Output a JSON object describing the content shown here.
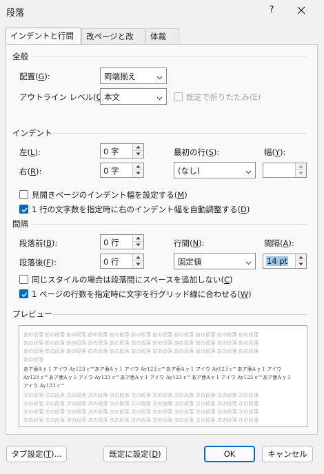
{
  "window": {
    "title": "段落",
    "help": "?"
  },
  "tabs": [
    {
      "label": "インデントと行間隔"
    },
    {
      "label": "改ページと改行"
    },
    {
      "label": "体裁"
    }
  ],
  "general": {
    "heading": "全般",
    "alignment": {
      "label_pre": "配置(",
      "key": "G",
      "label_post": "):",
      "value": "両端揃え"
    },
    "outline": {
      "label_pre": "アウトライン レベル(",
      "key": "O",
      "label_post": "):",
      "value": "本文"
    },
    "collapse": {
      "label": "既定で折りたたみ(E)",
      "checked": false,
      "enabled": false
    }
  },
  "indent": {
    "heading": "インデント",
    "left": {
      "label_pre": "左(",
      "key": "L",
      "label_post": "):",
      "value": "0 字"
    },
    "right": {
      "label_pre": "右(",
      "key": "R",
      "label_post": "):",
      "value": "0 字"
    },
    "first_line": {
      "label_pre": "最初の行(",
      "key": "S",
      "label_post": "):",
      "value": "(なし)"
    },
    "width": {
      "label_pre": "幅(",
      "key": "Y",
      "label_post": "):",
      "value": ""
    },
    "mirror": {
      "label_pre": "見開きページのインデント幅を設定する(",
      "key": "M",
      "label_post": ")",
      "checked": false
    },
    "auto_adjust": {
      "label_pre": "1 行の文字数を指定時に右のインデント幅を自動調整する(",
      "key": "D",
      "label_post": ")",
      "checked": true
    }
  },
  "spacing": {
    "heading": "間隔",
    "before": {
      "label_pre": "段落前(",
      "key": "B",
      "label_post": "):",
      "value": "0 行"
    },
    "after": {
      "label_pre": "段落後(",
      "key": "F",
      "label_post": "):",
      "value": "0 行"
    },
    "line_spacing": {
      "label_pre": "行間(",
      "key": "N",
      "label_post": "):",
      "value": "固定値"
    },
    "at": {
      "label_pre": "間隔(",
      "key": "A",
      "label_post": "):",
      "value": "14 pt"
    },
    "no_space_same_style": {
      "label_pre": "同じスタイルの場合は段落間にスペースを追加しない(",
      "key": "C",
      "label_post": ")",
      "checked": false
    },
    "snap_grid": {
      "label_pre": "1 ページの行数を指定時に文字を行グリッド線に合わせる(",
      "key": "W",
      "label_post": ")",
      "checked": true
    }
  },
  "preview": {
    "heading": "プレビュー",
    "lines": [
      "前の段落 前の段落 前の段落 前の段落 前の段落 前の段落 前の段落 前の段落 前の段落 前の段落 前の段落",
      "前の段落 前の段落 前の段落 前の段落 前の段落 前の段落 前の段落 前の段落 前の段落 前の段落 前の段落",
      "前の段落 前の段落 前の段落 前の段落 前の段落 前の段落 前の段落 前の段落 前の段落 前の段落 前の段落",
      "前の段落",
      "あア亜A y 1 アイウ Ay123 c™あア亜A y 1 アイウ Ay123 c™あア亜A y 1 アイウ Ay123 c™あア亜A y 1 アイウ",
      "Ay123 c™あア亜A y 1 アイウ Ay123 c™あア亜A y 1 アイウ Ay123 c™あア亜A y 1 アイウ Ay123 c™あア亜A y 1",
      "アイウ Ay123 c™",
      "次の段落 次の段落 次の段落 次の段落 次の段落 次の段落 次の段落 次の段落 次の段落 次の段落 次の段落",
      "次の段落 次の段落 次の段落 次の段落 次の段落 次の段落 次の段落 次の段落 次の段落 次の段落 次の段落",
      "次の段落 次の段落 次の段落 次の段落 次の段落 次の段落 次の段落 次の段落 次の段落 次の段落 次の段落",
      "次の段落 次の段落 次の段落 次の段落 次の段落 次の段落 次の段落 次の段落 次の段落 次の段落 次の段落"
    ]
  },
  "footer": {
    "tabs": {
      "label_pre": "タブ設定(",
      "key": "T",
      "label_post": ")..."
    },
    "set_default": {
      "label_pre": "既定に設定(",
      "key": "D",
      "label_post": ")"
    },
    "ok": "OK",
    "cancel": "キャンセル"
  },
  "colors": {
    "accent": "#0067c0",
    "selection": "#99c9ef"
  }
}
